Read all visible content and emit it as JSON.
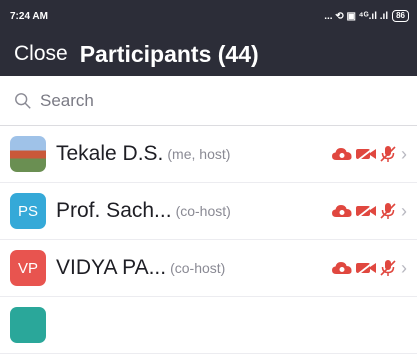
{
  "statusbar": {
    "time": "7:24 AM",
    "icons": [
      "dots-icon",
      "alarm-icon",
      "nfc-icon",
      "signal-icon",
      "signal-icon"
    ],
    "icons_text": "... ⟲ ▣ ⁴ᴳ.ıl .ıl",
    "battery": "86"
  },
  "header": {
    "close_label": "Close",
    "title": "Participants (44)"
  },
  "search": {
    "placeholder": "Search"
  },
  "colors": {
    "header_bg": "#2c2d38",
    "muted_red": "#e0473f",
    "ps_avatar": "#35a9d8",
    "vp_avatar": "#e8544f",
    "teal_avatar": "#2aa79a"
  },
  "participants": [
    {
      "name": "Tekale D.S.",
      "role": "(me, host)",
      "initials": "",
      "avatar": "photo"
    },
    {
      "name": "Prof. Sach...",
      "role": "(co-host)",
      "initials": "PS",
      "avatar": "#35a9d8"
    },
    {
      "name": "VIDYA PA...",
      "role": "(co-host)",
      "initials": "VP",
      "avatar": "#e8544f"
    },
    {
      "name": "",
      "role": "",
      "initials": "",
      "avatar": "#2aa79a"
    }
  ]
}
